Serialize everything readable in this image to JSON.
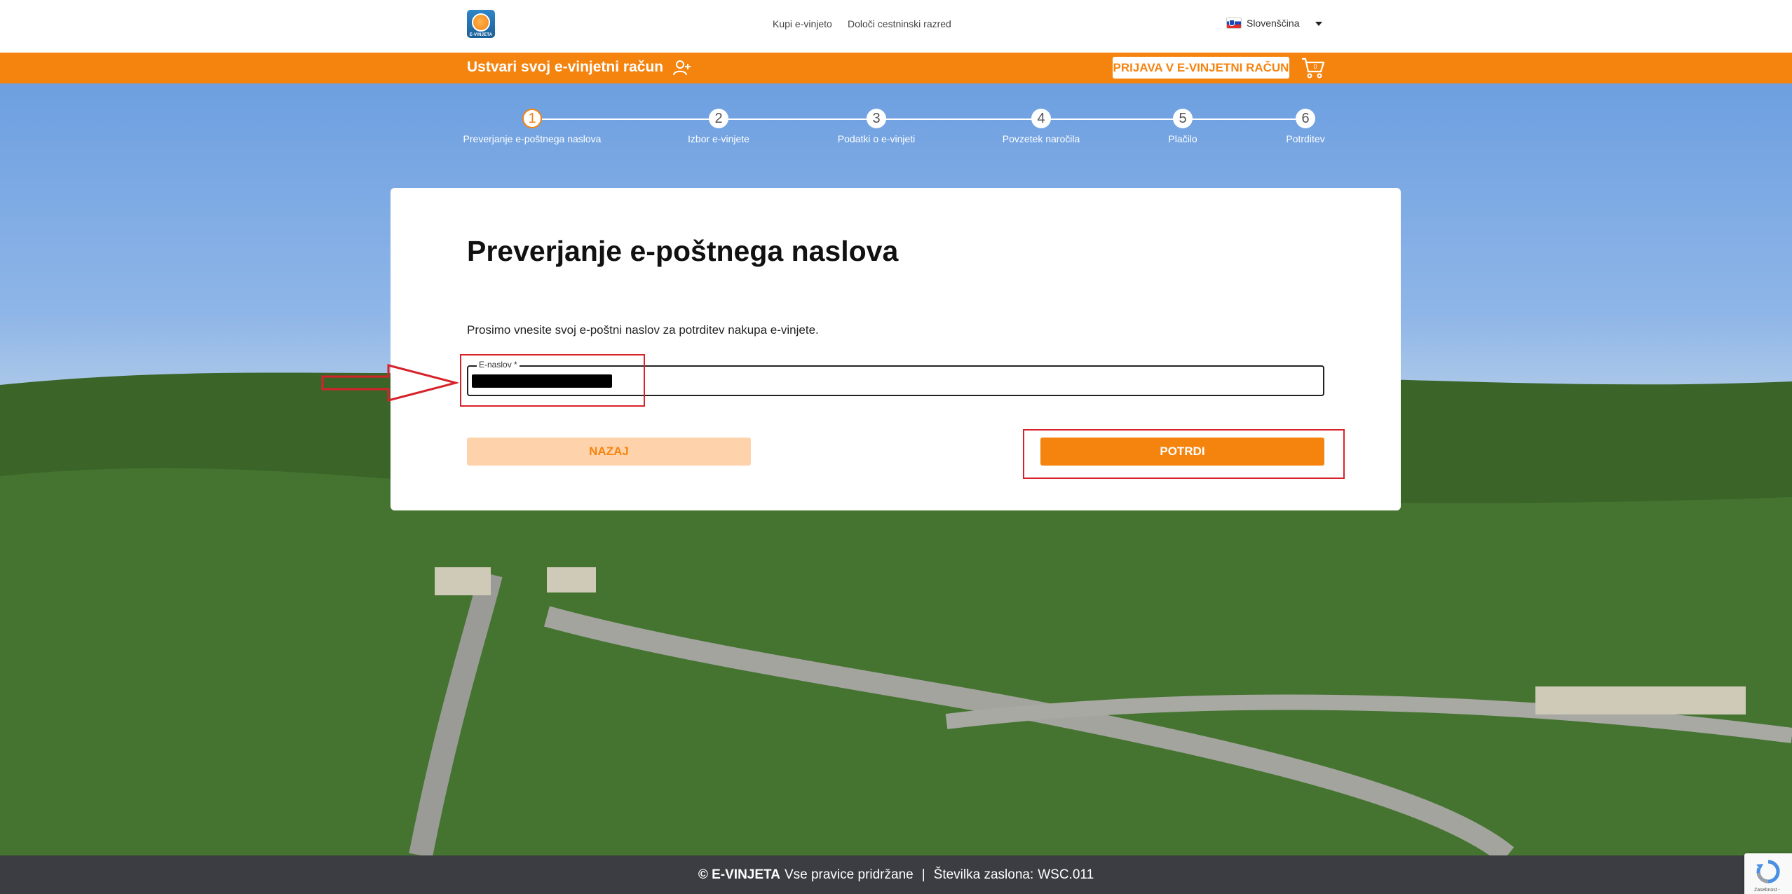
{
  "nav": {
    "logo_text": "E-VINJETA",
    "buy_link": "Kupi e-vinjeto",
    "class_link": "Določi cestninski razred",
    "language": "Slovenščina"
  },
  "bar": {
    "title": "Ustvari svoj e-vinjetni račun",
    "login": "PRIJAVA V E-VINJETNI RAČUN",
    "cart_count": "0"
  },
  "steps": [
    {
      "num": "1",
      "label": "Preverjanje e-poštnega naslova"
    },
    {
      "num": "2",
      "label": "Izbor e-vinjete"
    },
    {
      "num": "3",
      "label": "Podatki o e-vinjeti"
    },
    {
      "num": "4",
      "label": "Povzetek naročila"
    },
    {
      "num": "5",
      "label": "Plačilo"
    },
    {
      "num": "6",
      "label": "Potrditev"
    }
  ],
  "card": {
    "title": "Preverjanje e-poštnega naslova",
    "instruction": "Prosimo vnesite svoj e-poštni naslov za potrditev nakupa e-vinjete.",
    "email_label": "E-naslov *",
    "email_value": "",
    "back": "NAZAJ",
    "confirm": "POTRDI"
  },
  "footer": {
    "brand": "© E-VINJETA",
    "rights": "Vse pravice pridržane",
    "separator": "|",
    "screen_label": "Številka zaslona:",
    "screen_code": "WSC.011"
  },
  "recaptcha": {
    "text": "Zasebnost -"
  },
  "colors": {
    "accent": "#f5840f",
    "accent_light": "#fed3ac",
    "footer_bg": "#3c3d42",
    "annotation": "#d6232b"
  }
}
